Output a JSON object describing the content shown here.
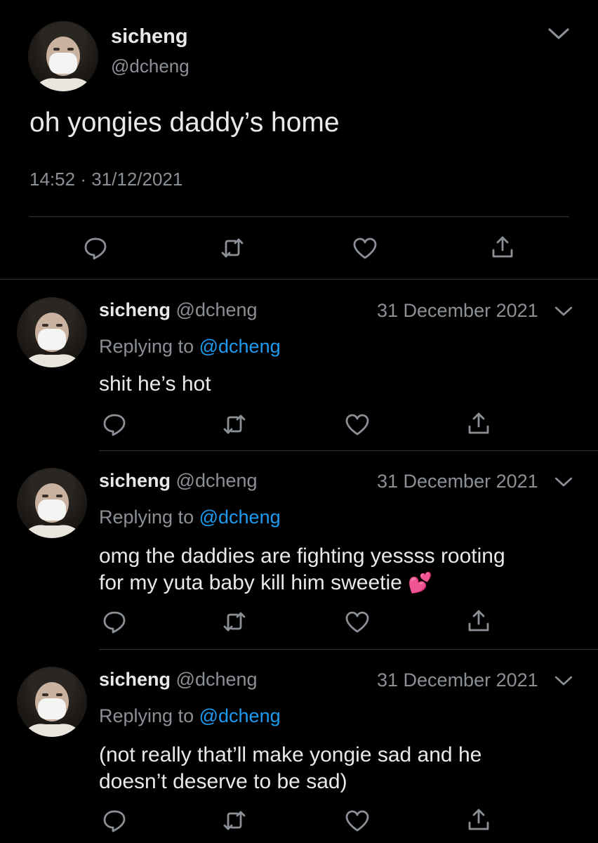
{
  "main_tweet": {
    "display_name": "sicheng",
    "handle": "@dcheng",
    "text": "oh yongies daddy’s home",
    "time": "14:52",
    "separator": "·",
    "date": "31/12/2021"
  },
  "replies": [
    {
      "display_name": "sicheng",
      "handle": "@dcheng",
      "date": "31 December 2021",
      "replying_prefix": "Replying to",
      "replying_handle": "@dcheng",
      "text_lines": [
        "shit he’s hot"
      ]
    },
    {
      "display_name": "sicheng",
      "handle": "@dcheng",
      "date": "31 December 2021",
      "replying_prefix": "Replying to",
      "replying_handle": "@dcheng",
      "text_lines": [
        "omg the daddies are fighting yessss rooting",
        "for my yuta baby kill him sweetie"
      ],
      "emoji": "💕"
    },
    {
      "display_name": "sicheng",
      "handle": "@dcheng",
      "date": "31 December 2021",
      "replying_prefix": "Replying to",
      "replying_handle": "@dcheng",
      "text_lines": [
        "(not really that’ll make yongie sad and he",
        "doesn’t deserve to be sad)"
      ]
    }
  ],
  "icons": {
    "reply": "reply-icon",
    "retweet": "retweet-icon",
    "like": "heart-icon",
    "share": "share-icon",
    "menu": "chevron-down-icon"
  },
  "colors": {
    "background": "#000000",
    "text": "#e7e9ea",
    "muted": "#8b9096",
    "link": "#1d9bf0",
    "divider": "#2f3336"
  }
}
